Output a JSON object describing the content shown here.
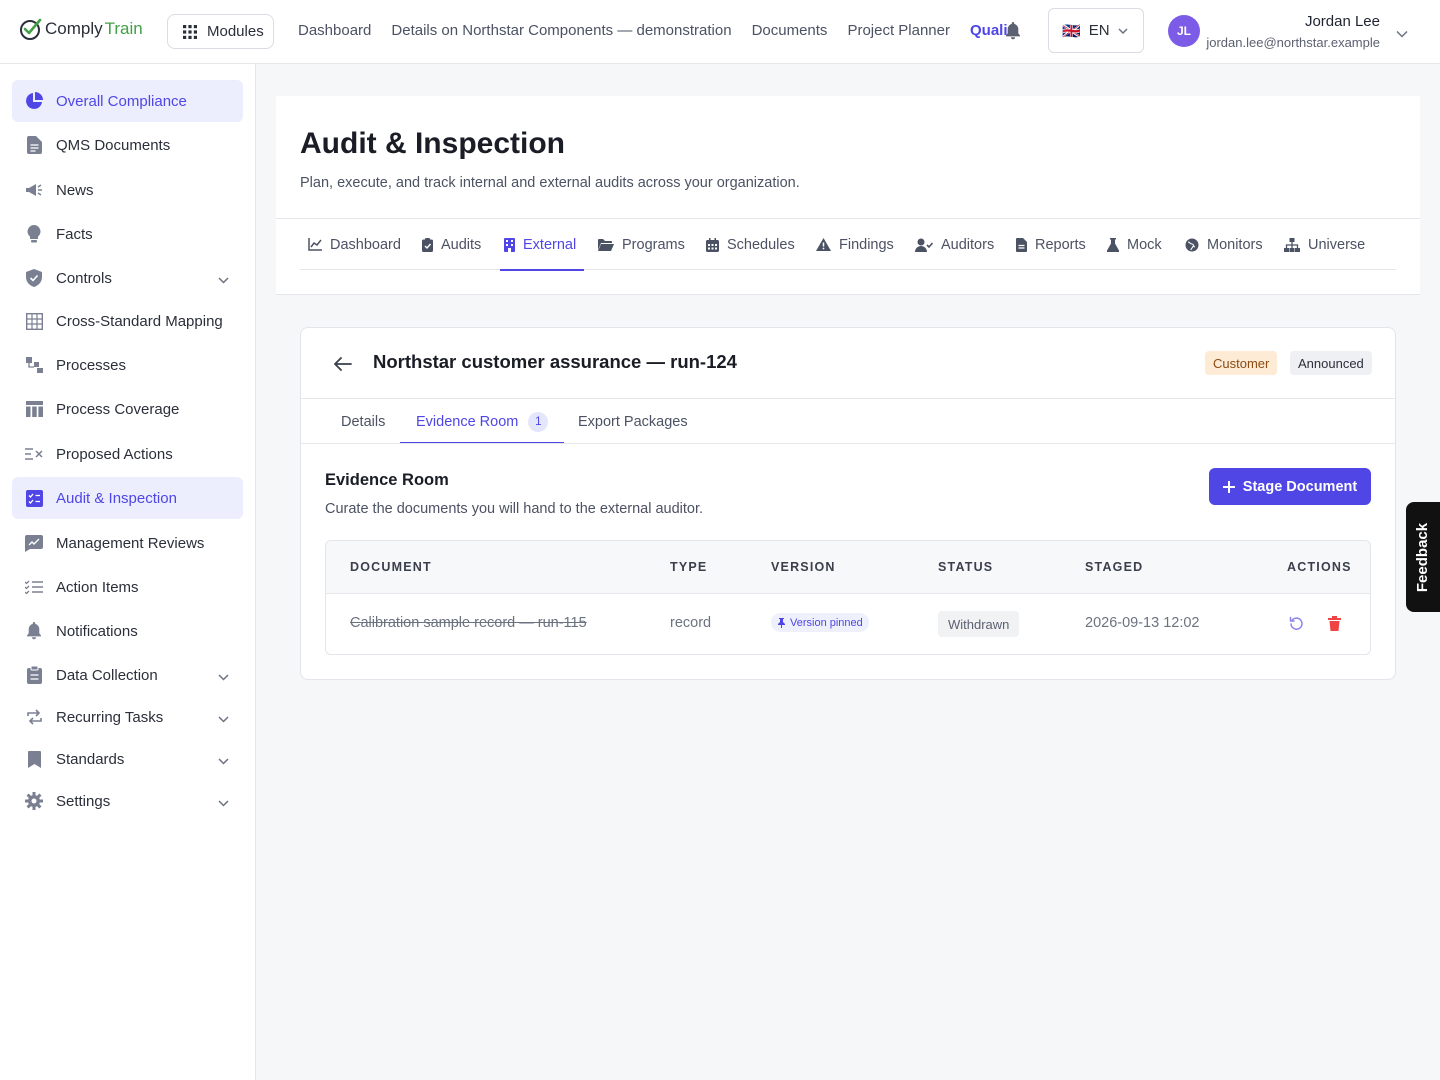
{
  "app": {
    "logo_part1": "Comply",
    "logo_part2": "Train",
    "modules_label": "Modules"
  },
  "topnav": [
    "Dashboard",
    "Details on Northstar Components — demonstration",
    "Documents",
    "Project Planner",
    "Quali"
  ],
  "language": {
    "flag": "🇬🇧",
    "code": "EN"
  },
  "user": {
    "initials": "JL",
    "name": "Jordan Lee",
    "email": "jordan.lee@northstar.example"
  },
  "sidebar": {
    "items": [
      {
        "label": "Overall Compliance",
        "icon": "pie-chart-icon"
      },
      {
        "label": "QMS Documents",
        "icon": "document-icon"
      },
      {
        "label": "News",
        "icon": "megaphone-icon"
      },
      {
        "label": "Facts",
        "icon": "lightbulb-icon"
      },
      {
        "label": "Controls",
        "icon": "shield-icon"
      },
      {
        "label": "Cross-Standard Mapping",
        "icon": "grid-icon"
      },
      {
        "label": "Processes",
        "icon": "process-icon"
      },
      {
        "label": "Process Coverage",
        "icon": "table-icon"
      },
      {
        "label": "Proposed Actions",
        "icon": "list-x-icon"
      },
      {
        "label": "Audit & Inspection",
        "icon": "checklist-icon"
      },
      {
        "label": "Management Reviews",
        "icon": "chart-edit-icon"
      },
      {
        "label": "Action Items",
        "icon": "list-check-icon"
      },
      {
        "label": "Notifications",
        "icon": "bell-icon"
      },
      {
        "label": "Data Collection",
        "icon": "clipboard-icon"
      },
      {
        "label": "Recurring Tasks",
        "icon": "repeat-icon"
      },
      {
        "label": "Standards",
        "icon": "bookmark-icon"
      },
      {
        "label": "Settings",
        "icon": "gear-icon"
      }
    ]
  },
  "page": {
    "title": "Audit & Inspection",
    "subtitle": "Plan, execute, and track internal and external audits across your organization."
  },
  "tabs": [
    "Dashboard",
    "Audits",
    "External",
    "Programs",
    "Schedules",
    "Findings",
    "Auditors",
    "Reports",
    "Mock",
    "Monitors",
    "Universe"
  ],
  "detail": {
    "title": "Northstar customer assurance — run-124",
    "badge_type": "Customer",
    "badge_state": "Announced",
    "subtabs": [
      "Details",
      "Evidence Room",
      "Export Packages"
    ],
    "evidence_count": "1"
  },
  "evidence": {
    "title": "Evidence Room",
    "subtitle": "Curate the documents you will hand to the external auditor.",
    "stage_button": "Stage Document",
    "columns": [
      "DOCUMENT",
      "TYPE",
      "VERSION",
      "STATUS",
      "STAGED",
      "ACTIONS"
    ],
    "rows": [
      {
        "document": "Calibration sample record — run-115",
        "type": "record",
        "version": "Version pinned",
        "status": "Withdrawn",
        "staged": "2026-09-13 12:02"
      }
    ]
  },
  "feedback_label": "Feedback",
  "colors": {
    "accent": "#4f46e5",
    "brand_green": "#43a047",
    "danger": "#ef4444"
  }
}
